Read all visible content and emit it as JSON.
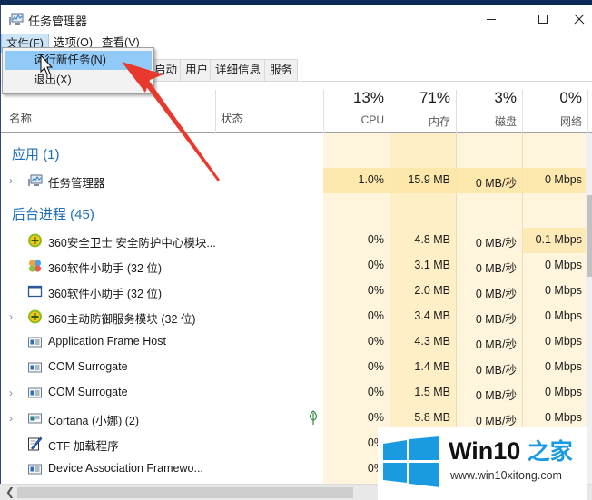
{
  "window": {
    "title": "任务管理器",
    "controls": {
      "minimize": "—",
      "maximize": "☐",
      "close": "✕"
    }
  },
  "menubar": {
    "items": [
      {
        "label": "文件(F)",
        "active": true
      },
      {
        "label": "选项(O)"
      },
      {
        "label": "查看(V)"
      }
    ]
  },
  "file_menu": {
    "items": [
      {
        "label": "运行新任务(N)",
        "highlighted": true
      },
      {
        "label": "退出(X)"
      }
    ]
  },
  "tabs": [
    {
      "label": "启动"
    },
    {
      "label": "用户"
    },
    {
      "label": "详细信息"
    },
    {
      "label": "服务"
    }
  ],
  "columns": {
    "name": "名称",
    "status": "状态",
    "cpu": {
      "percent": "13%",
      "label": "CPU"
    },
    "memory": {
      "percent": "71%",
      "label": "内存"
    },
    "disk": {
      "percent": "3%",
      "label": "磁盘"
    },
    "network": {
      "percent": "0%",
      "label": "网络"
    }
  },
  "groups": {
    "apps": "应用 (1)",
    "background": "后台进程 (45)"
  },
  "apps": [
    {
      "name": "任务管理器",
      "expandable": true,
      "icon": "task-manager-icon",
      "cpu": "1.0%",
      "memory": "15.9 MB",
      "disk": "0 MB/秒",
      "network": "0 Mbps"
    }
  ],
  "processes": [
    {
      "name": "360安全卫士 安全防护中心模块...",
      "expandable": false,
      "icon": "360-shield-icon",
      "cpu": "0%",
      "memory": "4.8 MB",
      "disk": "0 MB/秒",
      "network": "0.1 Mbps"
    },
    {
      "name": "360软件小助手 (32 位)",
      "expandable": false,
      "icon": "360-apps-icon",
      "cpu": "0%",
      "memory": "3.1 MB",
      "disk": "0 MB/秒",
      "network": "0 Mbps"
    },
    {
      "name": "360软件小助手 (32 位)",
      "expandable": false,
      "icon": "window-icon",
      "cpu": "0%",
      "memory": "2.0 MB",
      "disk": "0 MB/秒",
      "network": "0 Mbps"
    },
    {
      "name": "360主动防御服务模块 (32 位)",
      "expandable": true,
      "icon": "360-shield-icon",
      "cpu": "0%",
      "memory": "3.4 MB",
      "disk": "0 MB/秒",
      "network": "0 Mbps"
    },
    {
      "name": "Application Frame Host",
      "expandable": false,
      "icon": "app-frame-icon",
      "cpu": "0%",
      "memory": "4.3 MB",
      "disk": "0 MB/秒",
      "network": "0 Mbps"
    },
    {
      "name": "COM Surrogate",
      "expandable": false,
      "icon": "app-frame-icon",
      "cpu": "0%",
      "memory": "1.4 MB",
      "disk": "0 MB/秒",
      "network": "0 Mbps"
    },
    {
      "name": "COM Surrogate",
      "expandable": true,
      "icon": "app-frame-icon",
      "cpu": "0%",
      "memory": "1.5 MB",
      "disk": "0 MB/秒",
      "network": "0 Mbps"
    },
    {
      "name": "Cortana (小娜) (2)",
      "expandable": true,
      "icon": "cortana-icon",
      "status_icon": "leaf-icon",
      "cpu": "0%",
      "memory": "5.8 MB",
      "disk": "0 MB/秒",
      "network": "0 Mbps"
    },
    {
      "name": "CTF 加载程序",
      "expandable": false,
      "icon": "ctf-pen-icon",
      "cpu": "0%",
      "memory": "",
      "disk": "",
      "network": ""
    },
    {
      "name": "Device Association Framewo...",
      "expandable": false,
      "icon": "app-frame-icon",
      "cpu": "0%",
      "memory": "",
      "disk": "",
      "network": ""
    }
  ],
  "watermark": {
    "title": "Win10",
    "title_cn": "之家",
    "url": "www.win10xitong.com"
  },
  "colors": {
    "group_header": "#1e6fb8",
    "heat_light": "#fff4dc",
    "heat_mid": "#ffefc6",
    "heat_strong": "#fde5a6",
    "menu_highlight": "#91c9f7",
    "arrow_red": "#e8392e",
    "watermark_blue": "#1a9ae0"
  }
}
